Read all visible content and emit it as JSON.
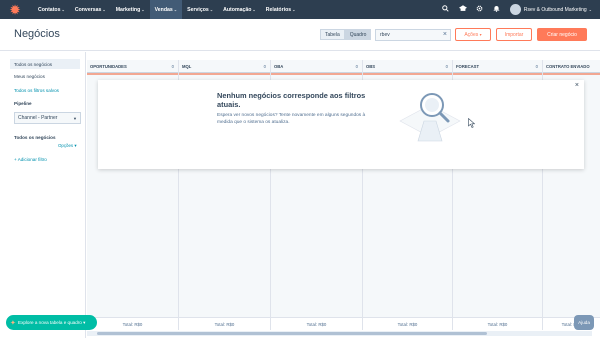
{
  "nav": {
    "logo": "hubspot-sprocket",
    "items": [
      {
        "label": "Contatos",
        "active": false
      },
      {
        "label": "Conversas",
        "active": false
      },
      {
        "label": "Marketing",
        "active": false
      },
      {
        "label": "Vendas",
        "active": true
      },
      {
        "label": "Serviços",
        "active": false
      },
      {
        "label": "Automação",
        "active": false
      },
      {
        "label": "Relatórios",
        "active": false
      }
    ],
    "icons": [
      "search-icon",
      "academy-icon",
      "gear-icon",
      "bell-icon"
    ],
    "account": "Rsev & Outbound Marketing"
  },
  "header": {
    "title": "Negócios",
    "view_table": "Tabela",
    "view_board": "Quadro",
    "search_value": "rbev",
    "actions_label": "Ações",
    "import_label": "Importar",
    "create_label": "Criar negócio"
  },
  "sidebar": {
    "views": [
      "Todos os negócios",
      "Meus negócios"
    ],
    "saved_filters": "Todos os filtros salvos",
    "pipeline_label": "Pipeline",
    "pipeline_value": "Channel - Partner",
    "filters_label": "Todos os negócios",
    "options_label": "Opções",
    "add_filter": "Adicionar filtro"
  },
  "board": {
    "columns": [
      {
        "name": "OPORTUNIDADES",
        "count": "0",
        "total": "Total: R$0"
      },
      {
        "name": "MQL",
        "count": "0",
        "total": "Total: R$0"
      },
      {
        "name": "OBA",
        "count": "0",
        "total": "Total: R$0"
      },
      {
        "name": "OBS",
        "count": "0",
        "total": "Total: R$0"
      },
      {
        "name": "FORECAST",
        "count": "0",
        "total": "Total: R$0"
      },
      {
        "name": "CONTRATO ENVIADO",
        "count": "",
        "total": "Total: R$0"
      }
    ]
  },
  "empty_state": {
    "title": "Nenhum negócios corresponde aos filtros atuais.",
    "description": "Espera ver novos negócios? Tente novamente em alguns segundos à medida que o sistema os atualiza."
  },
  "footer": {
    "tour_label": "Explore a nova tabela e quadro",
    "help_label": "Ajuda"
  },
  "colors": {
    "nav_bg": "#2d3e50",
    "accent": "#ff7a59",
    "teal": "#0091ae",
    "tour": "#00bda5"
  }
}
